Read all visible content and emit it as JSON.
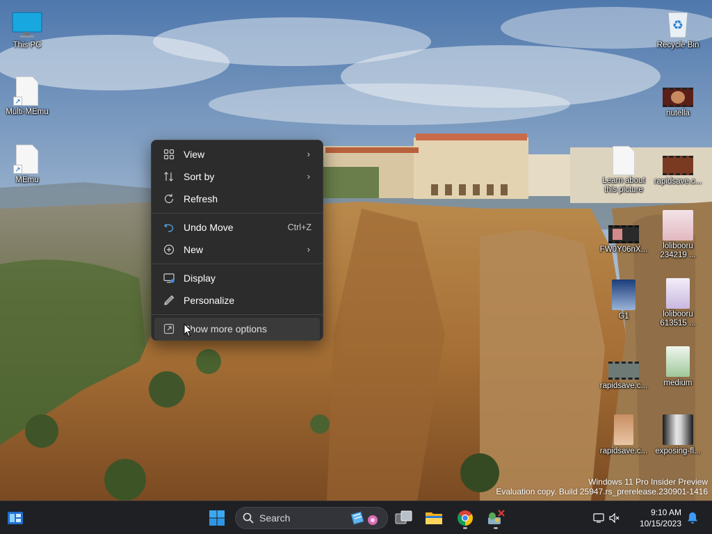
{
  "desktop": {
    "icons_left": [
      {
        "label": "This PC",
        "icon": "monitor-icon"
      },
      {
        "label": "Multi-MEmu",
        "icon": "shortcut-file-icon"
      },
      {
        "label": "MEmu",
        "icon": "shortcut-file-icon"
      }
    ],
    "icons_right": [
      {
        "label": "Recycle Bin",
        "icon": "recycle-bin-icon"
      },
      {
        "label": "nutella",
        "icon": "video-thumbnail-icon"
      },
      {
        "label": "Learn about this picture",
        "icon": "file-icon"
      },
      {
        "label": "rapidsave.c...",
        "icon": "video-thumbnail-icon"
      },
      {
        "label": "FW0Y06nX...",
        "icon": "video-thumbnail-icon"
      },
      {
        "label": "lolibooru 234219 ...",
        "icon": "image-thumbnail-icon"
      },
      {
        "label": "G1",
        "icon": "image-thumbnail-icon"
      },
      {
        "label": "lolibooru 613515 ...",
        "icon": "image-thumbnail-icon"
      },
      {
        "label": "rapidsave.c...",
        "icon": "video-thumbnail-icon"
      },
      {
        "label": "medium",
        "icon": "image-thumbnail-icon"
      },
      {
        "label": "rapidsave.c...",
        "icon": "image-thumbnail-icon"
      },
      {
        "label": "exposing-fl...",
        "icon": "image-thumbnail-icon"
      }
    ]
  },
  "context_menu": {
    "items": [
      {
        "label": "View",
        "icon": "grid-icon",
        "submenu": true
      },
      {
        "label": "Sort by",
        "icon": "sort-icon",
        "submenu": true
      },
      {
        "label": "Refresh",
        "icon": "refresh-icon"
      },
      {
        "label": "Undo Move",
        "icon": "undo-icon",
        "shortcut": "Ctrl+Z"
      },
      {
        "label": "New",
        "icon": "plus-circle-icon",
        "submenu": true
      },
      {
        "label": "Display",
        "icon": "display-icon"
      },
      {
        "label": "Personalize",
        "icon": "pen-icon"
      },
      {
        "label": "Show more options",
        "icon": "open-external-icon",
        "hovered": true
      }
    ],
    "submenu_arrow": "›"
  },
  "watermark": {
    "line1": "Windows 11 Pro Insider Preview",
    "line2": "Evaluation copy. Build 25947.rs_prerelease.230901-1416"
  },
  "taskbar": {
    "search_label": "Search",
    "apps": [
      "start-icon",
      "task-view-icon",
      "file-explorer-icon",
      "chrome-icon",
      "app-icon"
    ],
    "clock_time": "9:10 AM",
    "clock_date": "10/15/2023"
  },
  "colors": {
    "menu_bg": "#2c2c2c",
    "taskbar_bg": "#1f2024",
    "accent": "#0a84ff"
  }
}
